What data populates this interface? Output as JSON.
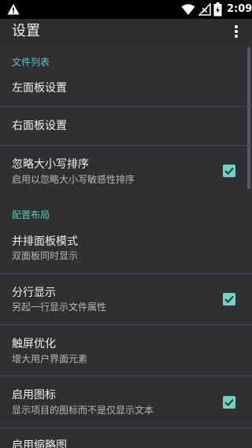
{
  "status_bar": {
    "time": "2:09"
  },
  "toolbar": {
    "title": "设置"
  },
  "sections": [
    {
      "label": "文件列表"
    },
    {
      "label": "配置布局"
    }
  ],
  "items": [
    {
      "title": "左面板设置"
    },
    {
      "title": "右面板设置"
    },
    {
      "title": "忽略大小写排序",
      "subtitle": "启用以忽略大小写敏感性排序",
      "checked": true
    },
    {
      "title": "并排面板模式",
      "subtitle": "双面板同时显示"
    },
    {
      "title": "分行显示",
      "subtitle": "另起一行显示文件属性",
      "checked": true
    },
    {
      "title": "触屏优化",
      "subtitle": "增大用户界面元素"
    },
    {
      "title": "启用图标",
      "subtitle": "显示项目的图标而不是仅显示文本",
      "checked": true
    },
    {
      "title": "启用缩略图"
    }
  ],
  "colors": {
    "accent": "#73d1c4",
    "section_header": "#5fc8b0",
    "background": "#2f3032"
  },
  "icons": [
    "warning-icon",
    "wifi-icon",
    "signal-icon",
    "battery-icon",
    "overflow-menu-icon",
    "checkbox-checked-icon"
  ]
}
